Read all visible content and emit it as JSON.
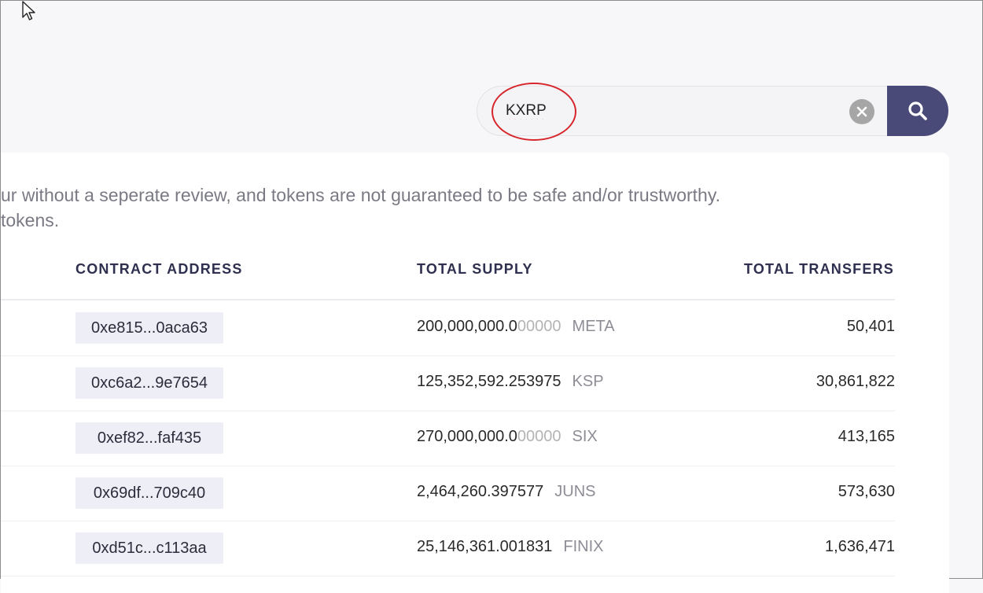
{
  "search": {
    "value": "KXRP"
  },
  "notice": {
    "line1": "ur without a seperate review, and tokens are not guaranteed to be safe and/or trustworthy.",
    "line2": "tokens."
  },
  "table": {
    "headers": {
      "contract_address": "CONTRACT ADDRESS",
      "total_supply": "TOTAL SUPPLY",
      "total_transfers": "TOTAL TRANSFERS"
    },
    "rows": [
      {
        "address": "0xe815...0aca63",
        "supply_int": "200,000,000.0",
        "supply_dec": "00000",
        "symbol": "META",
        "transfers": "50,401"
      },
      {
        "address": "0xc6a2...9e7654",
        "supply_int": "125,352,592.253975",
        "supply_dec": "",
        "symbol": "KSP",
        "transfers": "30,861,822"
      },
      {
        "address": "0xef82...faf435",
        "supply_int": "270,000,000.0",
        "supply_dec": "00000",
        "symbol": "SIX",
        "transfers": "413,165"
      },
      {
        "address": "0x69df...709c40",
        "supply_int": "2,464,260.397577",
        "supply_dec": "",
        "symbol": "JUNS",
        "transfers": "573,630"
      },
      {
        "address": "0xd51c...c113aa",
        "supply_int": "25,146,361.001831",
        "supply_dec": "",
        "symbol": "FINIX",
        "transfers": "1,636,471"
      }
    ]
  },
  "colors": {
    "search_button": "#4a4a78",
    "annotation": "#d6262c",
    "header_text": "#2f2f4f"
  },
  "icons": {
    "cursor": "mouse-pointer-icon",
    "clear": "clear-x-icon",
    "search": "search-icon"
  }
}
